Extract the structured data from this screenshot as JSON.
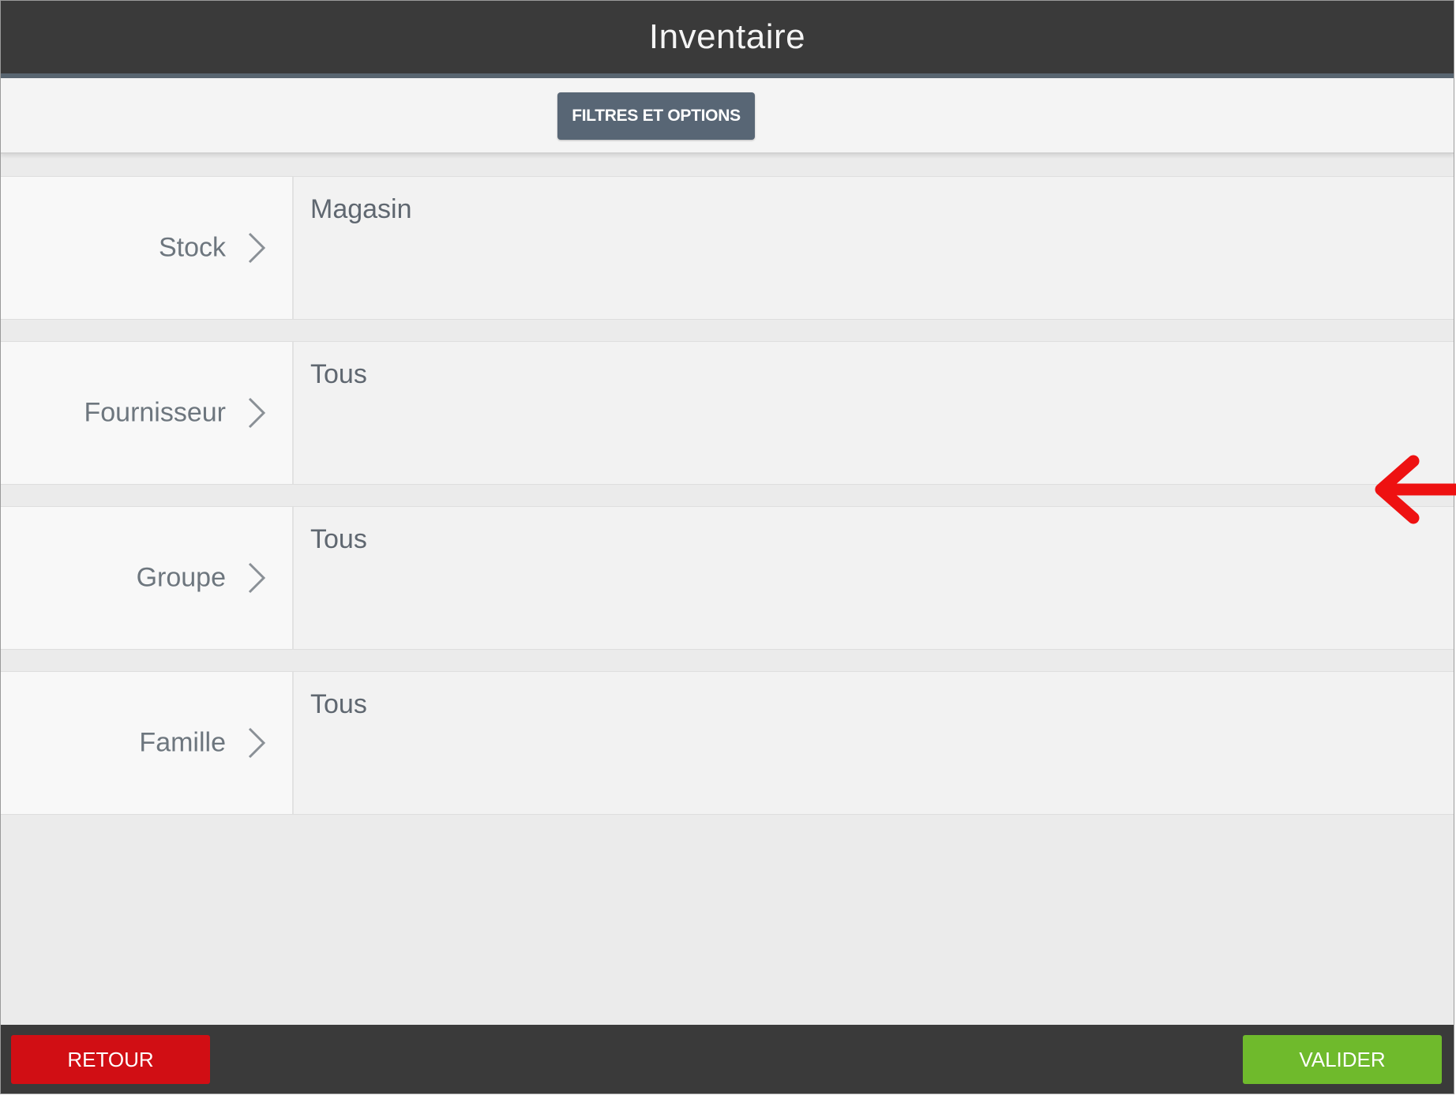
{
  "header": {
    "title": "Inventaire"
  },
  "toolbar": {
    "filters_label": "FILTRES ET OPTIONS"
  },
  "rows": [
    {
      "label": "Stock",
      "value": "Magasin"
    },
    {
      "label": "Fournisseur",
      "value": "Tous"
    },
    {
      "label": "Groupe",
      "value": "Tous"
    },
    {
      "label": "Famille",
      "value": "Tous"
    }
  ],
  "footer": {
    "back_label": "RETOUR",
    "validate_label": "VALIDER"
  },
  "colors": {
    "header_bg": "#3a3a3a",
    "filter_button": "#586675",
    "back_button": "#d10e14",
    "validate_button": "#6fba2c",
    "annotation_arrow": "#ee1111"
  },
  "icons": {
    "row_chevron": "chevron-right-icon",
    "annotation": "arrow-left-icon"
  }
}
